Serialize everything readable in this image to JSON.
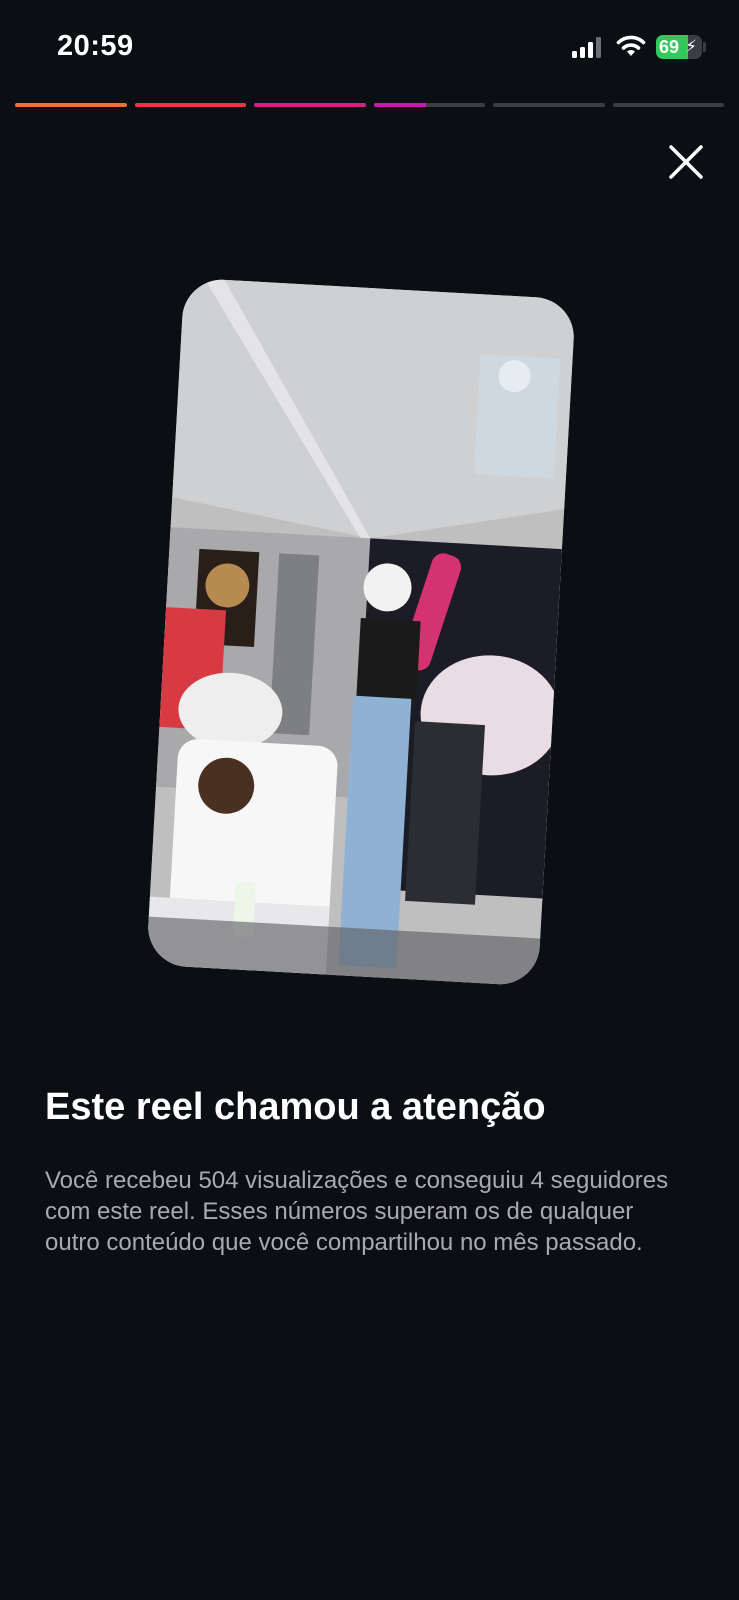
{
  "status_bar": {
    "time": "20:59",
    "battery_percent": "69",
    "battery_level": 0.69,
    "charging": true
  },
  "stories_progress": {
    "segments": [
      {
        "fill": 1.0,
        "color": "#f0712a"
      },
      {
        "fill": 1.0,
        "color": "#e8344a"
      },
      {
        "fill": 1.0,
        "color": "#d81f84"
      },
      {
        "fill": 0.47,
        "color": "#c41bb4"
      },
      {
        "fill": 0.0,
        "color": "#3a3d42"
      },
      {
        "fill": 0.0,
        "color": "#3a3d42"
      }
    ]
  },
  "close_icon": "close-icon",
  "reel": {
    "headline": "Este reel chamou a atenção",
    "description": "Você recebeu 504 visualizações e conseguiu 4 seguidores com este reel. Esses números superam os de qualquer outro conteúdo que você compartilhou no mês passado."
  },
  "colors": {
    "background": "#0b0f14",
    "text_primary": "#ffffff",
    "text_secondary": "#a7abb1"
  }
}
